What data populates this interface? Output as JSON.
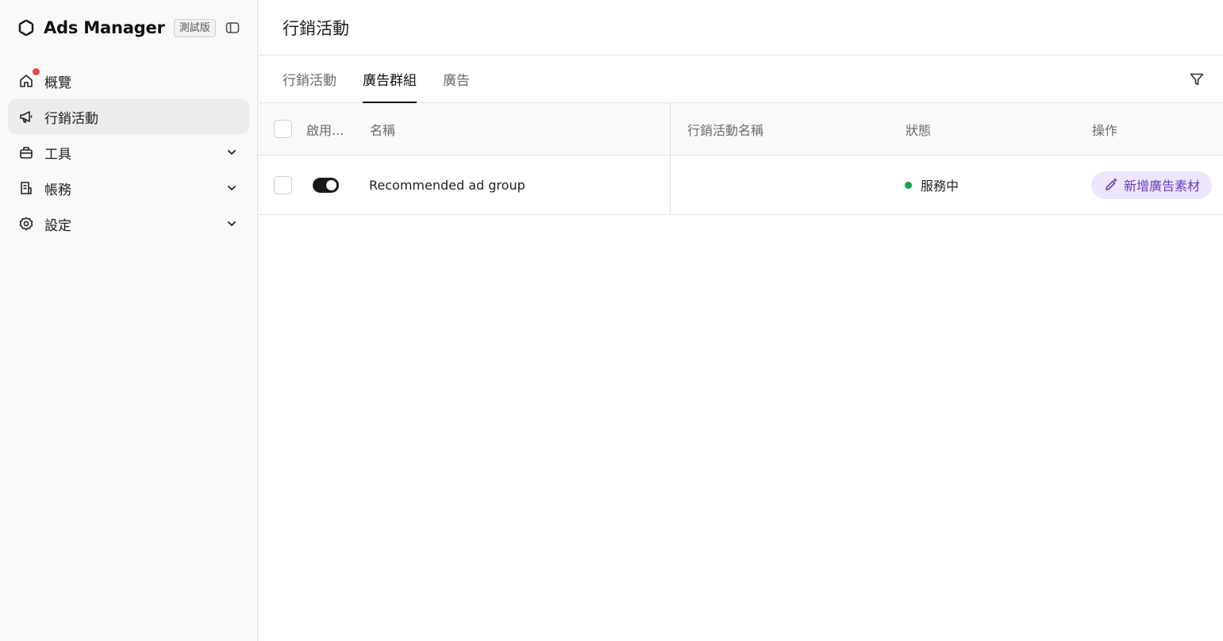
{
  "sidebar": {
    "brand_title": "Ads Manager",
    "beta_badge": "測試版",
    "items": [
      {
        "label": "概覽",
        "icon": "home-icon",
        "active": false,
        "expandable": false,
        "notification": true
      },
      {
        "label": "行銷活動",
        "icon": "megaphone-icon",
        "active": true,
        "expandable": false
      },
      {
        "label": "工具",
        "icon": "toolbox-icon",
        "active": false,
        "expandable": true
      },
      {
        "label": "帳務",
        "icon": "receipt-icon",
        "active": false,
        "expandable": true
      },
      {
        "label": "設定",
        "icon": "gear-icon",
        "active": false,
        "expandable": true
      }
    ]
  },
  "header": {
    "title": "行銷活動"
  },
  "tabs": [
    {
      "label": "行銷活動",
      "active": false
    },
    {
      "label": "廣告群組",
      "active": true
    },
    {
      "label": "廣告",
      "active": false
    }
  ],
  "table": {
    "columns": {
      "enabled": "啟用...",
      "name": "名稱",
      "campaign_name": "行銷活動名稱",
      "status": "狀態",
      "actions": "操作"
    },
    "rows": [
      {
        "enabled": true,
        "name": "Recommended ad group",
        "campaign_name": "",
        "status": "服務中",
        "action_label": "新增廣告素材"
      }
    ]
  },
  "colors": {
    "status_active": "#16a34a",
    "action_bg": "#ede5fb",
    "action_text": "#6b3bbd",
    "notification": "#ef4444"
  }
}
